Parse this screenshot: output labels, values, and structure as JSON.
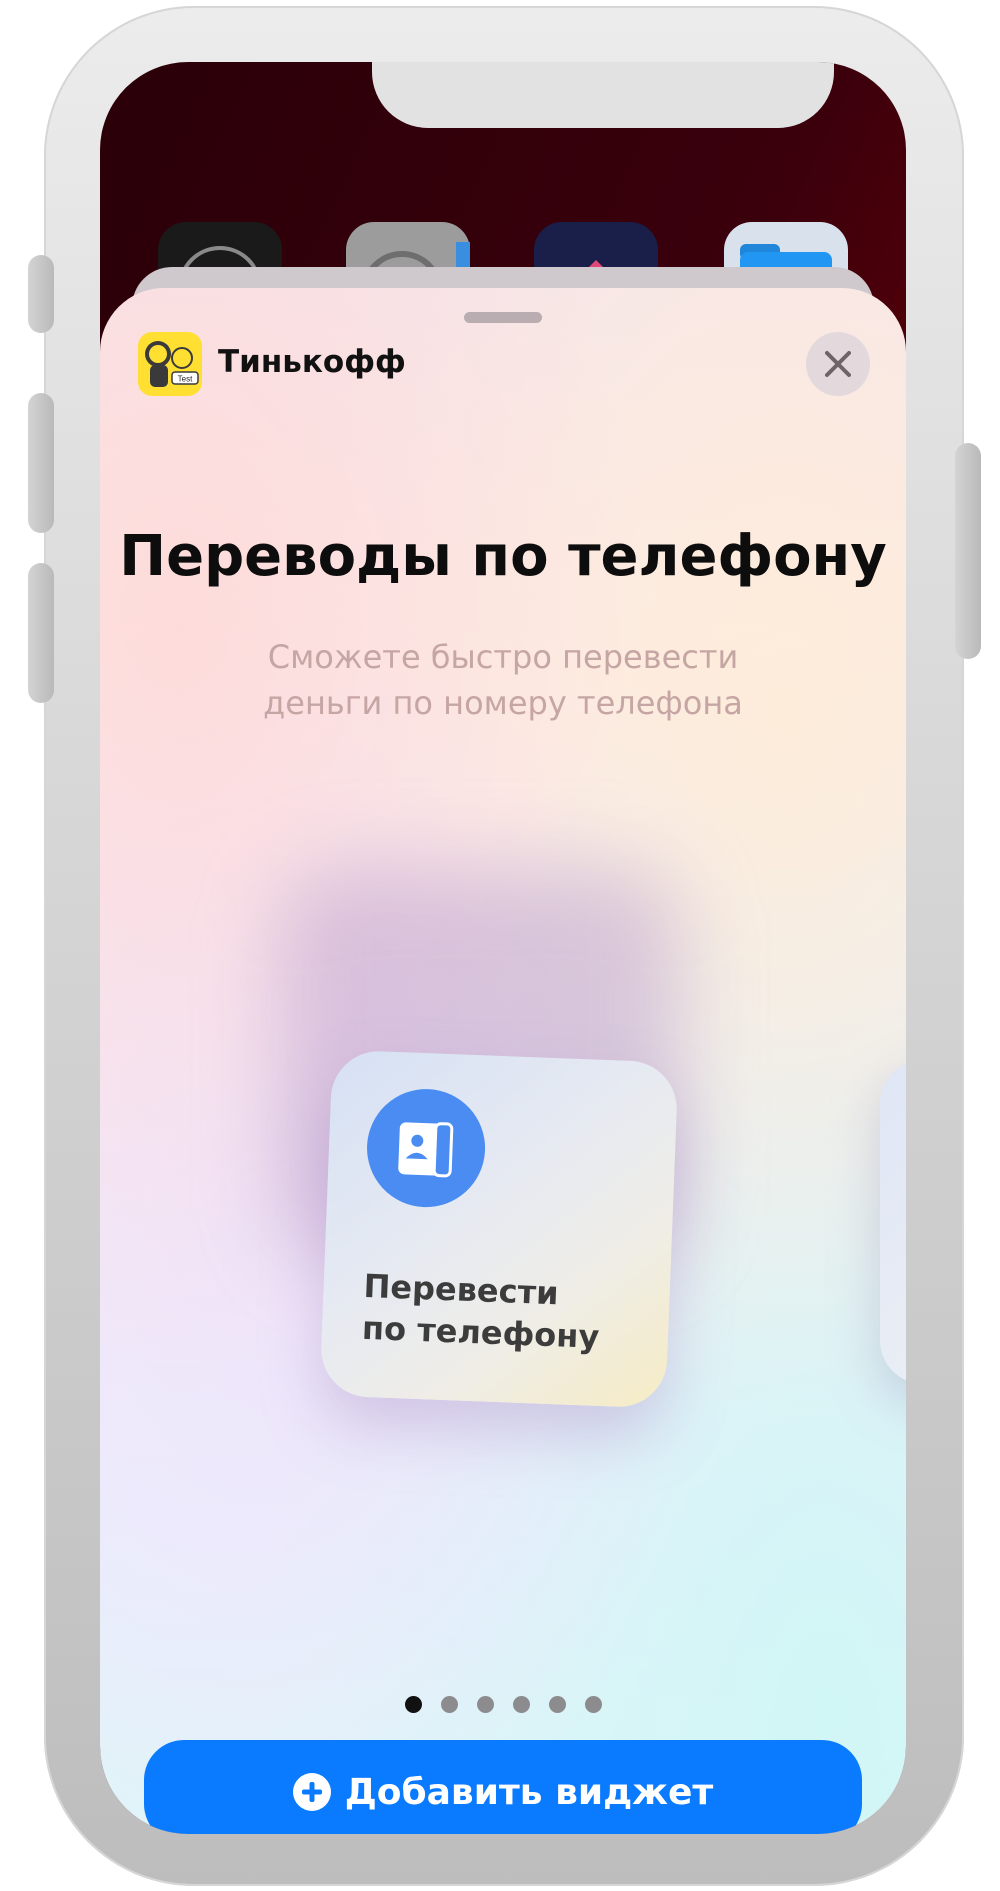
{
  "brand": {
    "name": "Тинькофф",
    "logo_badge": "Test",
    "logo_icon": "astronaut-logo-icon"
  },
  "sheet": {
    "title": "Переводы по телефону",
    "subtitle_lines": [
      "Сможете быстро перевести",
      "деньги по номеру телефона"
    ],
    "close_icon": "close-icon"
  },
  "widget": {
    "icon": "contacts-icon",
    "label_lines": [
      "Перевести",
      "по телефону"
    ]
  },
  "pagination": {
    "total": 6,
    "active": 1
  },
  "add_button": {
    "label": "Добавить виджет",
    "icon": "plus-circle-icon"
  },
  "colors": {
    "accent": "#0a7aff",
    "widget_icon_bg": "#4a8cf2",
    "brand_yellow": "#ffe032"
  }
}
